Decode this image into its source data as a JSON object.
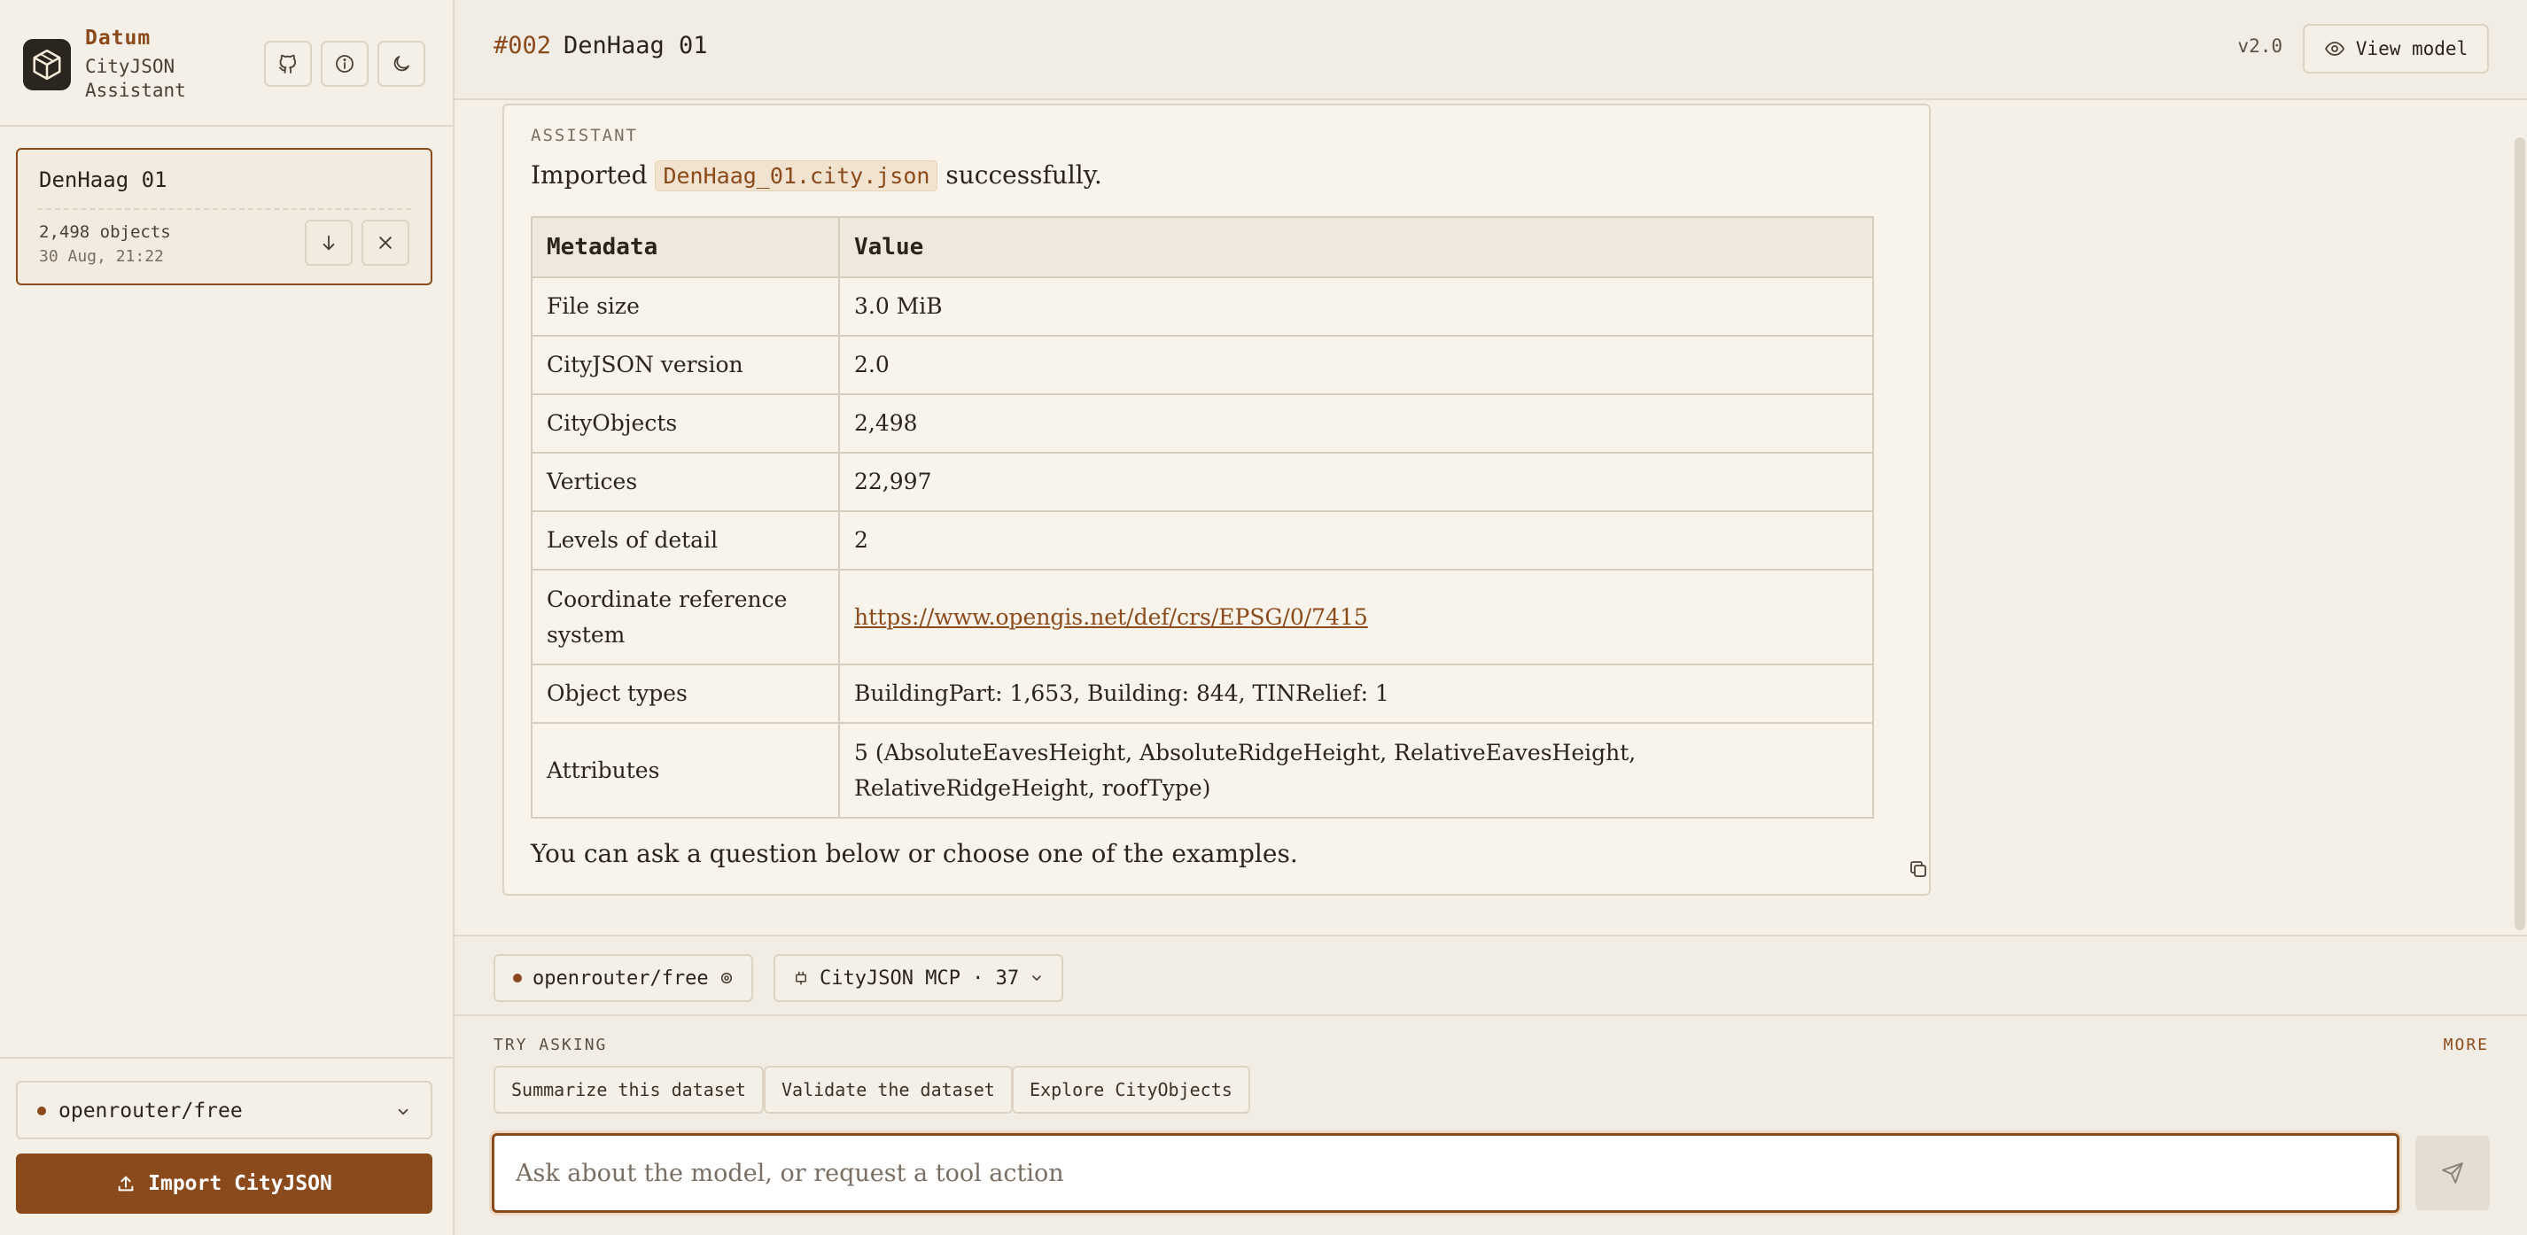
{
  "sidebar": {
    "brand_name": "Datum",
    "brand_sub": "CityJSON Assistant",
    "icons": [
      "github-icon",
      "info-icon",
      "moon-icon"
    ],
    "session": {
      "title": "DenHaag 01",
      "count": "2,498 objects",
      "date": "30 Aug, 21:22"
    },
    "model_select": "openrouter/free",
    "import_label": "Import CityJSON"
  },
  "header": {
    "conv_id": "#002",
    "conv_title": "DenHaag 01",
    "version": "v2.0",
    "view_model_label": "View model"
  },
  "message": {
    "role": "ASSISTANT",
    "intro_before": "Imported",
    "filename": "DenHaag_01.city.json",
    "intro_after": "successfully.",
    "table": {
      "headers": [
        "Metadata",
        "Value"
      ],
      "rows": [
        {
          "k": "File size",
          "v": "3.0 MiB"
        },
        {
          "k": "CityJSON version",
          "v": "2.0"
        },
        {
          "k": "CityObjects",
          "v": "2,498"
        },
        {
          "k": "Vertices",
          "v": "22,997"
        },
        {
          "k": "Levels of detail",
          "v": "2"
        },
        {
          "k": "Coordinate reference system",
          "v": "https://www.opengis.net/def/crs/EPSG/0/7415"
        },
        {
          "k": "Object types",
          "v": "BuildingPart: 1,653, Building: 844, TINRelief: 1"
        },
        {
          "k": "Attributes",
          "v": "5 (AbsoluteEavesHeight, AbsoluteRidgeHeight, RelativeEavesHeight, RelativeRidgeHeight, roofType)"
        }
      ]
    },
    "outro": "You can ask a question below or choose one of the examples."
  },
  "toolbar": {
    "model_pill": "openrouter/free",
    "mcp_pill": "CityJSON MCP · 37"
  },
  "composer": {
    "try_label": "TRY ASKING",
    "more_label": "MORE",
    "suggestions": [
      "Summarize this dataset",
      "Validate the dataset",
      "Explore CityObjects"
    ],
    "placeholder": "Ask about the model, or request a tool action"
  },
  "colors": {
    "accent": "#8b4a1c",
    "background": "#f5f0e7",
    "border": "#ddd3c3"
  }
}
